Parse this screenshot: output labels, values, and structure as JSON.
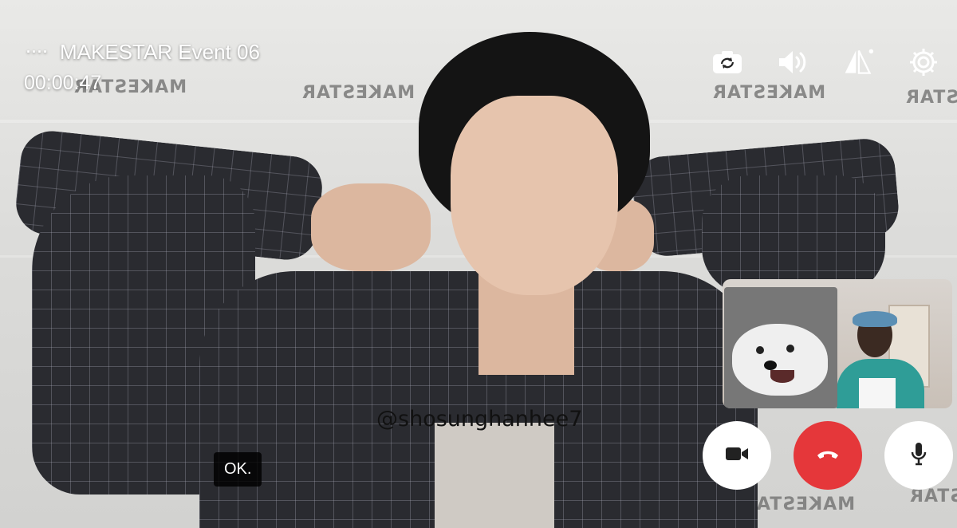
{
  "call": {
    "title": "MAKESTAR Event 06",
    "signal_glyph": "····",
    "elapsed": "00:00:47"
  },
  "backdrop": {
    "logo_text": "MAKESTAR"
  },
  "watermark": "@shosunghanhee7",
  "subtitle": "OK.",
  "top_controls": [
    {
      "icon": "camera-switch-icon"
    },
    {
      "icon": "speaker-icon"
    },
    {
      "icon": "flip-view-icon"
    },
    {
      "icon": "gear-icon"
    }
  ],
  "bottom_controls": [
    {
      "icon": "video-camera-icon",
      "color": "#ffffff"
    },
    {
      "icon": "end-call-icon",
      "color": "#e5373a"
    },
    {
      "icon": "microphone-icon",
      "color": "#ffffff"
    }
  ],
  "colors": {
    "end_call": "#e5373a",
    "overlay_text": "#ffffff"
  }
}
